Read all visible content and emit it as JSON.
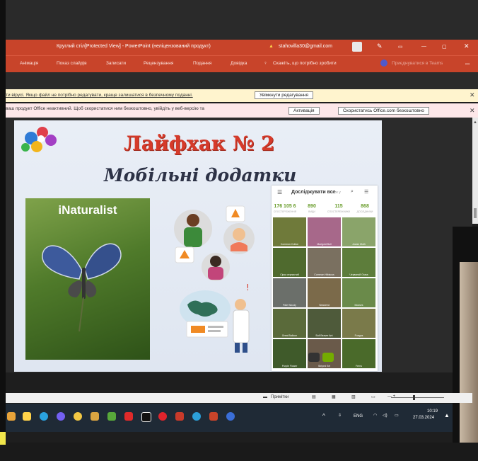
{
  "window": {
    "title": "Круглий стіл[Protected View] - PowerPoint (неліцензований продукт)",
    "account": "stahovilla30@gmail.com",
    "controls": [
      "⚐",
      "▭",
      "—",
      "▢",
      "✕"
    ]
  },
  "ribbon": {
    "tabs": [
      "Анімація",
      "Показ слайдів",
      "Записати",
      "Рецензування",
      "Подання",
      "Довідка"
    ],
    "search": "Скажіть, що потрібно зробити",
    "share": "Приєднуватися в Teams"
  },
  "messages": {
    "protected": "ти вірусі. Якщо файл не потрібно редагувати, краще залишатися в безпечному поданні.",
    "enable_editing": "Увімкнути редагування",
    "inactive": "ваш продукт Office неактивний. Щоб скористатися ним безкоштовно, увійдіть у веб-версію та",
    "activate": "Активація",
    "use_online": "Скористатись Office.com безкоштовно"
  },
  "slide": {
    "title": "Лайфхак № 2",
    "subtitle": "Мобільні додатки",
    "logo_text": "iNaturalist",
    "app_header": "Досліджувати все",
    "app_search_hint": "все у",
    "stats": [
      {
        "value": "176 105 6",
        "label": "СПОСТЕРЕЖЕННЯ"
      },
      {
        "value": "890",
        "label": "ВИДИ"
      },
      {
        "value": "115",
        "label": "СПОСТЕРЕЖНИКИ"
      },
      {
        "value": "868",
        "label": "ДОСЛІДНИКИ"
      }
    ],
    "grid": [
      "Common Cotton",
      "Marigold Bull",
      "Jovian Moth",
      "Сірка серпастий",
      "Common Hibiscus",
      "Червоний Grass",
      "Pale Woody",
      "Seaweed",
      "Mosses",
      "Great Balloon",
      "Bull Beaver Ant",
      "Fungus",
      "Purple Flower",
      "Striped Eel",
      "Ferns"
    ]
  },
  "status": {
    "notes": "Примітки",
    "zoom_label": "— + "
  },
  "taskbar": {
    "lang": "ENG",
    "time": "10:19",
    "date": "27.03.2024"
  },
  "colors": {
    "accent": "#c8442a",
    "title_red": "#d63a2a",
    "app_green": "#6a9d2c"
  }
}
